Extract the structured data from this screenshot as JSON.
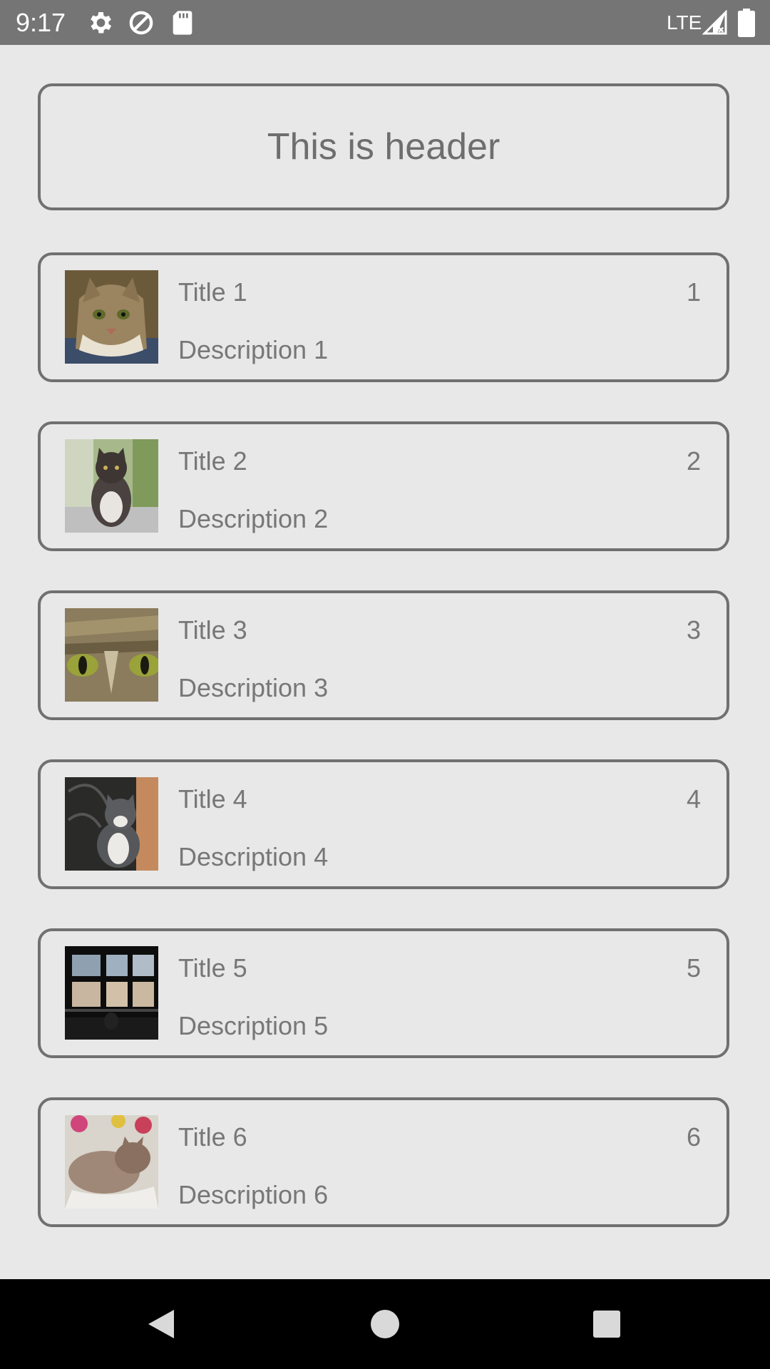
{
  "status_bar": {
    "time": "9:17",
    "icons": [
      "settings-icon",
      "data-saver-icon",
      "sd-card-icon"
    ],
    "network": "LTE",
    "right_icons": [
      "signal-icon",
      "battery-icon"
    ]
  },
  "header": {
    "text": "This is header"
  },
  "items": [
    {
      "title": "Title 1",
      "description": "Description 1",
      "number": "1",
      "image": "cat-photo-1"
    },
    {
      "title": "Title 2",
      "description": "Description 2",
      "number": "2",
      "image": "cat-photo-2"
    },
    {
      "title": "Title 3",
      "description": "Description 3",
      "number": "3",
      "image": "cat-photo-3"
    },
    {
      "title": "Title 4",
      "description": "Description 4",
      "number": "4",
      "image": "cat-photo-4"
    },
    {
      "title": "Title 5",
      "description": "Description 5",
      "number": "5",
      "image": "cat-photo-5"
    },
    {
      "title": "Title 6",
      "description": "Description 6",
      "number": "6",
      "image": "cat-photo-6"
    }
  ],
  "nav_bar": {
    "buttons": [
      "back-icon",
      "home-icon",
      "recents-icon"
    ]
  },
  "colors": {
    "status_bar": "#757575",
    "background": "#e8e8e8",
    "border": "#707070",
    "text": "#777777",
    "nav_bar": "#000000"
  }
}
